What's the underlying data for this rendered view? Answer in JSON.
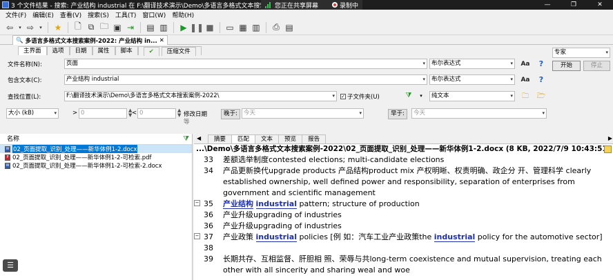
{
  "titlebar": {
    "title": "3 个文件结果 - 搜索: 产业结构 industrial 在 F:\\翻译技术演示\\Demo\\多语言多格式文本搜索案例-2022",
    "sharing": "您正在共享屏幕",
    "recording": "录制中"
  },
  "menu": [
    "文件(F)",
    "编辑(E)",
    "查看(V)",
    "搜索(S)",
    "工具(T)",
    "窗口(W)",
    "帮助(H)"
  ],
  "tab": {
    "title": "多语言多格式文本搜索案例-2022: 产业结构 in..."
  },
  "form_tabs": [
    "主界面",
    "选项",
    "日期",
    "属性",
    "脚本",
    "压缩文件"
  ],
  "form": {
    "file_name_label": "文件名称(N):",
    "file_name_value": "页面",
    "file_name_mode": "布尔表达式",
    "contains_label": "包含文本(C):",
    "contains_value": "产业结构 industrial",
    "contains_mode": "布尔表达式",
    "location_label": "查找位置(L):",
    "location_value": "F:\\翻译技术演示\\Demo\\多语言多格式文本搜索案例-2022\\",
    "subfolder_label": "子文件夹(U)",
    "filter_value": "纯文本",
    "size_label": "大小 (kB)",
    "size_min_op": ">",
    "size_min": "0",
    "size_max_op": "<",
    "size_max": "0",
    "mod_date_label": "修改日期",
    "mod_date_sub": "等",
    "later_label": "晚于:",
    "later_placeholder": "今天",
    "earlier_label": "早于:",
    "earlier_placeholder": "今天",
    "aa": "Aa",
    "help": "?"
  },
  "right_panel": {
    "profile": "专家",
    "start": "开始",
    "stop": "停止"
  },
  "results": {
    "header": "名称",
    "files": [
      {
        "name": "02_页面提取_识别_处理——新华体例1-2.docx",
        "type": "docx",
        "selected": true
      },
      {
        "name": "02_页面提取_识别_处理——新华体例1-2-可检索.pdf",
        "type": "pdf",
        "selected": false
      },
      {
        "name": "02_页面提取_识别_处理——新华体例1-2-可检索-2.docx",
        "type": "docx",
        "selected": false
      }
    ]
  },
  "preview": {
    "tabs": [
      "摘要",
      "匹配",
      "文本",
      "预览",
      "报告"
    ],
    "path": "...\\Demo\\多语言多格式文本搜索案例-2022\\02_页面提取_识别_处理——新华体例1-2.docx   (8 KB,  2022/7/9 10:43:51)",
    "lines": [
      {
        "n": "33",
        "parts": [
          {
            "t": "差额选举制度contested elections; multi-candidate elections"
          }
        ]
      },
      {
        "n": "34",
        "parts": [
          {
            "t": "产品更新换代upgrade products 产品结构product mix 产权明晰、权责明确、政企分 开、管理科学 clearly established ownership, well defined power and responsibility, separation of enterprises from government and scientific management"
          }
        ]
      },
      {
        "n": "35",
        "fold": true,
        "parts": [
          {
            "t": "产业结构",
            "hl": true
          },
          {
            "t": " "
          },
          {
            "t": "industrial",
            "hl": true
          },
          {
            "t": " pattern; structure of production"
          }
        ]
      },
      {
        "n": "36",
        "parts": [
          {
            "t": "产业升级upgrading of industries"
          }
        ]
      },
      {
        "n": "36",
        "parts": [
          {
            "t": "产业升级upgrading of industries"
          }
        ]
      },
      {
        "n": "37",
        "fold": true,
        "parts": [
          {
            "t": "产业政策 "
          },
          {
            "t": "industrial",
            "hl": true
          },
          {
            "t": " policies [例 如：汽车工业产业政策the "
          },
          {
            "t": "industrial",
            "hl": true
          },
          {
            "t": " policy for the automotive sector]"
          }
        ]
      },
      {
        "n": "38",
        "parts": []
      },
      {
        "n": "39",
        "parts": [
          {
            "t": "长期共存、互相监督、肝胆相 照、荣辱与共long-term coexistence and mutual supervision, treating each other with all sincerity and sharing weal and woe"
          }
        ]
      }
    ]
  },
  "colors": {
    "accent": "#0078d7",
    "highlight": "#1c2fb5",
    "titlebar": "#1e1e1e"
  }
}
